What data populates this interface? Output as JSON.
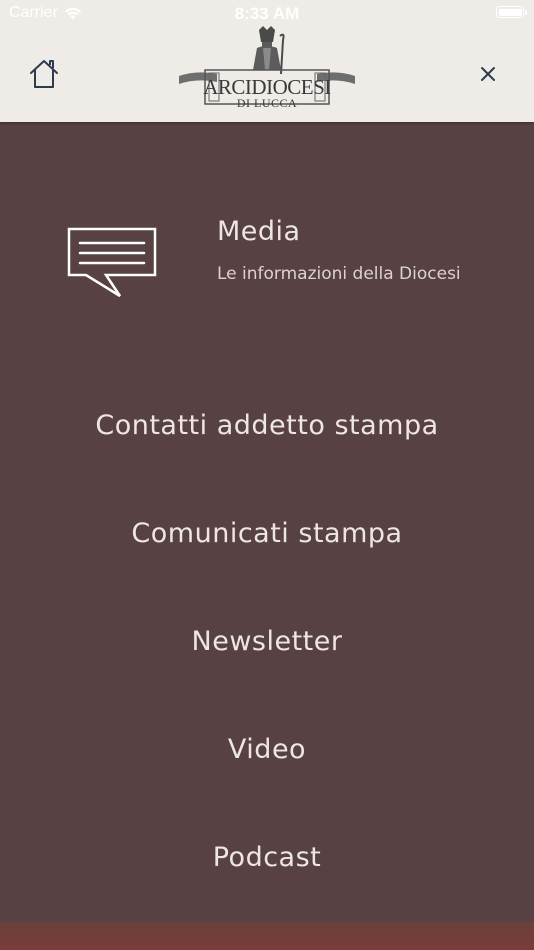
{
  "status_bar": {
    "carrier": "Carrier",
    "time": "8:33 AM"
  },
  "header": {
    "logo_title": "ARCIDIOCESI",
    "logo_subtitle": "DI LUCCA"
  },
  "section": {
    "title": "Media",
    "subtitle": "Le informazioni della Diocesi",
    "icon": "speech-bubble-icon"
  },
  "menu": {
    "items": [
      {
        "label": "Contatti addetto stampa"
      },
      {
        "label": "Comunicati stampa"
      },
      {
        "label": "Newsletter"
      },
      {
        "label": "Video"
      },
      {
        "label": "Podcast"
      }
    ]
  },
  "colors": {
    "background": "#574143",
    "header": "#efece8",
    "text": "#ede6e3",
    "accent_strip": "#7a3c39"
  }
}
